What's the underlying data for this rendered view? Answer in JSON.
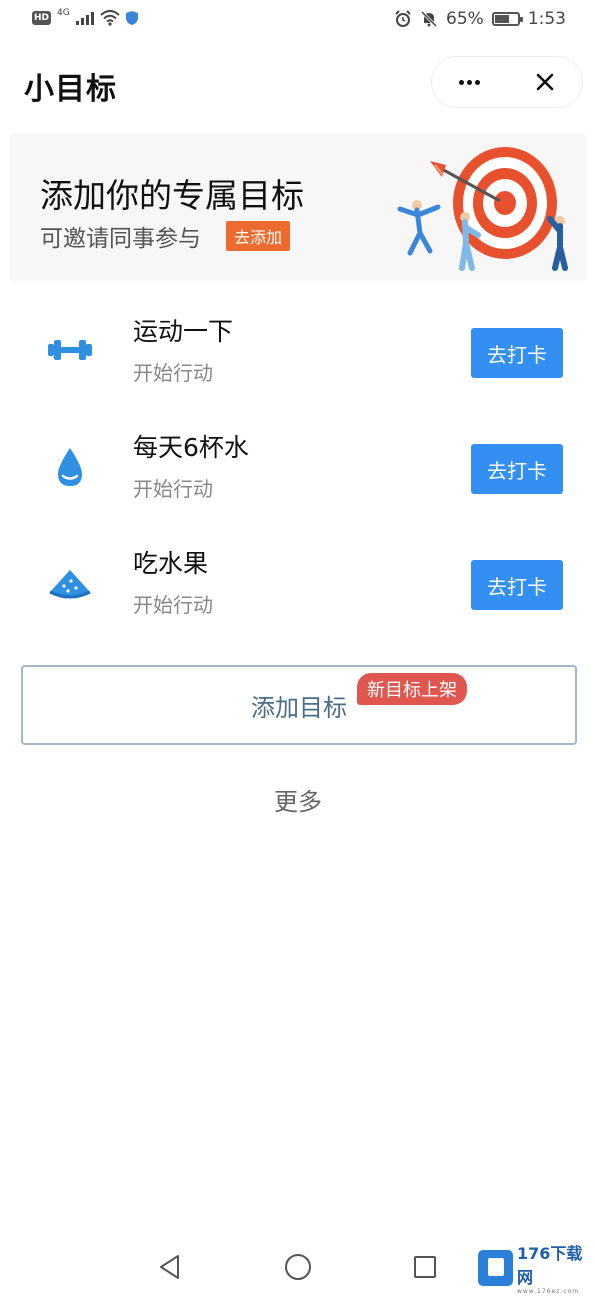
{
  "status_bar": {
    "hd": "HD",
    "network": "4G",
    "battery_percent": "65%",
    "battery_level": 0.65,
    "time": "1:53",
    "icons": [
      "signal-icon",
      "wifi-icon",
      "shield-icon",
      "alarm-icon",
      "mute-icon",
      "battery-icon"
    ]
  },
  "header": {
    "title": "小目标",
    "more_icon": "more-dots-icon",
    "close_icon": "close-icon"
  },
  "banner": {
    "title": "添加你的专属目标",
    "subtitle": "可邀请同事参与",
    "action": "去添加",
    "illustration": "target-dart-illustration"
  },
  "goals": [
    {
      "name": "运动一下",
      "status": "开始行动",
      "button": "去打卡",
      "icon": "dumbbell-icon"
    },
    {
      "name": "每天6杯水",
      "status": "开始行动",
      "button": "去打卡",
      "icon": "water-drop-icon"
    },
    {
      "name": "吃水果",
      "status": "开始行动",
      "button": "去打卡",
      "icon": "watermelon-icon"
    }
  ],
  "add_goal": {
    "label": "添加目标",
    "badge": "新目标上架"
  },
  "more": "更多",
  "watermark": {
    "main": "176下载网",
    "sub": "www.176ez.com"
  },
  "colors": {
    "primary_button": "#3390f2",
    "banner_tag": "#ee6b2f",
    "new_badge": "#e0574f",
    "icon_blue": "#2f8fe0"
  }
}
